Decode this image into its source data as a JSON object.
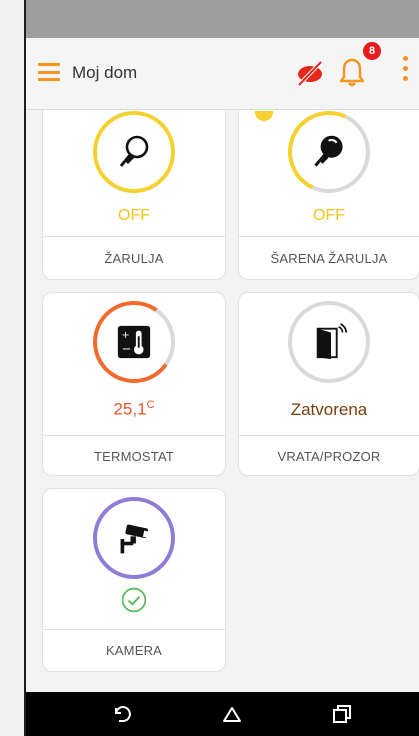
{
  "app_bar": {
    "title": "Moj dom",
    "notification_count": "8",
    "icons": [
      "menu-icon",
      "visibility-off-icon",
      "bell-icon",
      "more-vert-icon"
    ]
  },
  "devices": [
    {
      "label": "ŽARULJA",
      "state": "OFF",
      "icon": "light-bulb-icon"
    },
    {
      "label": "ŠARENA ŽARULJA",
      "state": "OFF",
      "icon": "color-bulb-icon"
    },
    {
      "label": "TERMOSTAT",
      "state": "25,1",
      "unit": "C",
      "icon": "thermostat-icon"
    },
    {
      "label": "VRATA/PROZOR",
      "state": "Zatvorena",
      "icon": "door-sensor-icon"
    },
    {
      "label": "KAMERA",
      "state": "",
      "icon": "security-camera-icon"
    }
  ],
  "colors": {
    "accent": "#f7931e",
    "bulb_ring": "#f5d130",
    "thermostat_ring": "#f26a2e",
    "thermostat_text": "#e8562a",
    "door_text": "#7a3e0e",
    "camera_ring": "#8e7cd6",
    "ok_green": "#5cb85c",
    "badge": "#e81c1c"
  },
  "nav_bar": {
    "buttons": [
      "back-icon",
      "home-icon",
      "recents-icon"
    ]
  }
}
